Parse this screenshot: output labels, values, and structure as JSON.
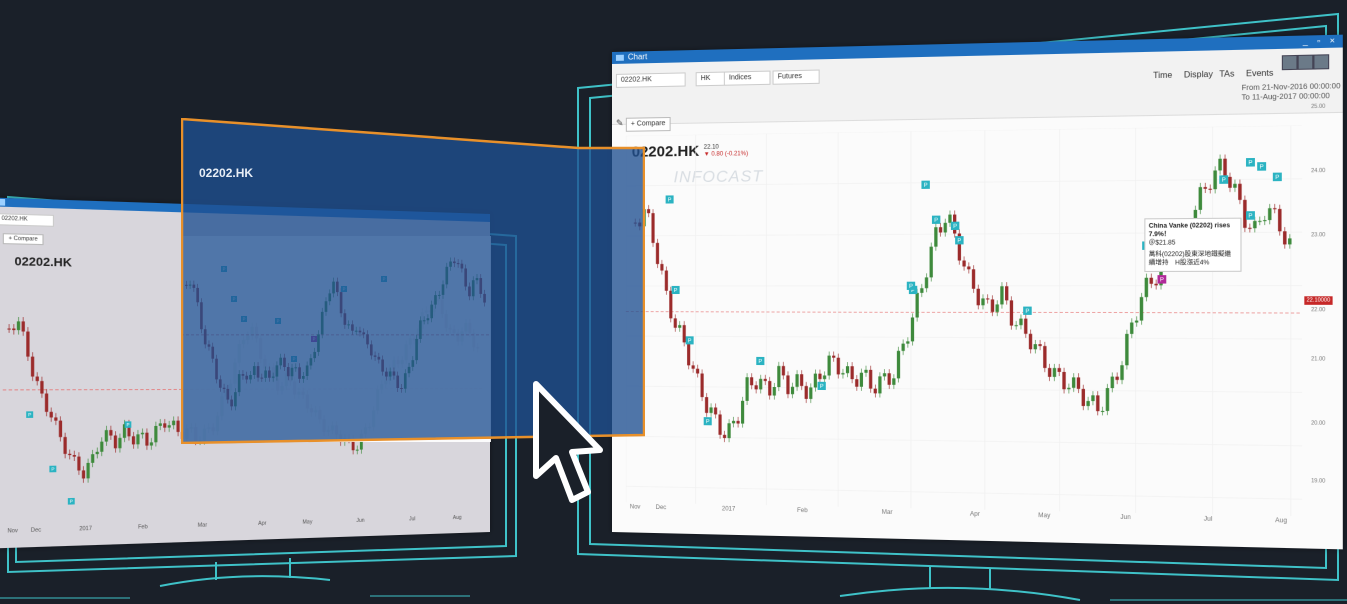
{
  "colors": {
    "background": "#1a2029",
    "monitor_outline": "#3fc2c8",
    "selection_fill": "#1f4f91",
    "selection_border": "#e8902a",
    "candle_up": "#3e8a3c",
    "candle_down": "#9b2b2b",
    "marker": "#2bb3c2",
    "marker_alt": "#b12a9a",
    "window_titlebar": "#1f6fbf"
  },
  "right_window": {
    "title": "Chart",
    "window_controls": "_ ▫ ×",
    "symbol_field": "02202.HK",
    "market": "HK",
    "category": "Indices",
    "type": "Futures",
    "menu": [
      "Time",
      "Display",
      "TAs",
      "Events"
    ],
    "from_label": "From",
    "from_value": "21-Nov-2016 00:00:00",
    "to_label": "To",
    "to_value": "11-Aug-2017 00:00:00",
    "compare_label": "+ Compare",
    "symbol": "02202.HK",
    "price_line1": "22.10",
    "price_line2": "▼ 0.80 (-0.21%)",
    "watermark": "INFOCAST",
    "x_labels": [
      "Nov",
      "Dec",
      "2017",
      "Feb",
      "Mar",
      "Apr",
      "May",
      "Jun",
      "Jul",
      "Aug"
    ],
    "y_labels": [
      "25.00",
      "24.00",
      "23.00",
      "22.00",
      "21.00",
      "20.00",
      "19.00"
    ],
    "tooltip_line1": "China Vanke (02202) rises 7.9%！",
    "tooltip_line2": "＠$21.85",
    "tooltip_line3": "萬科(02202)股東深地鐵擬繼續增持　H股漲近4%",
    "price_tag": "22.10000",
    "marker_letter": "P"
  },
  "left_window": {
    "symbol_field": "02202.HK",
    "compare_label": "+ Compare",
    "symbol": "02202.HK",
    "x_labels": [
      "Nov",
      "Dec",
      "2017",
      "Feb",
      "Mar",
      "Apr",
      "May",
      "Jun",
      "Jul",
      "Aug"
    ]
  },
  "selection": {
    "symbol": "02202.HK"
  }
}
